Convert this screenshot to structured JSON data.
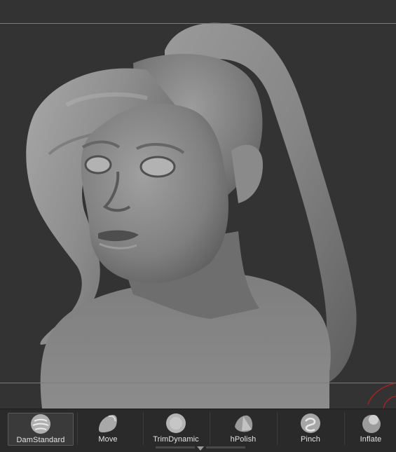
{
  "viewport": {
    "background": "#333333",
    "model": "sculpted-head-bust"
  },
  "brush_shelf": {
    "selected": "DamStandard",
    "brushes": [
      {
        "label": "DamStandard",
        "icon": "damstandard-brush-icon"
      },
      {
        "label": "Move",
        "icon": "move-brush-icon"
      },
      {
        "label": "TrimDynamic",
        "icon": "trimdynamic-brush-icon"
      },
      {
        "label": "hPolish",
        "icon": "hpolish-brush-icon"
      },
      {
        "label": "Pinch",
        "icon": "pinch-brush-icon"
      },
      {
        "label": "Inflate",
        "icon": "inflate-brush-icon"
      }
    ]
  }
}
